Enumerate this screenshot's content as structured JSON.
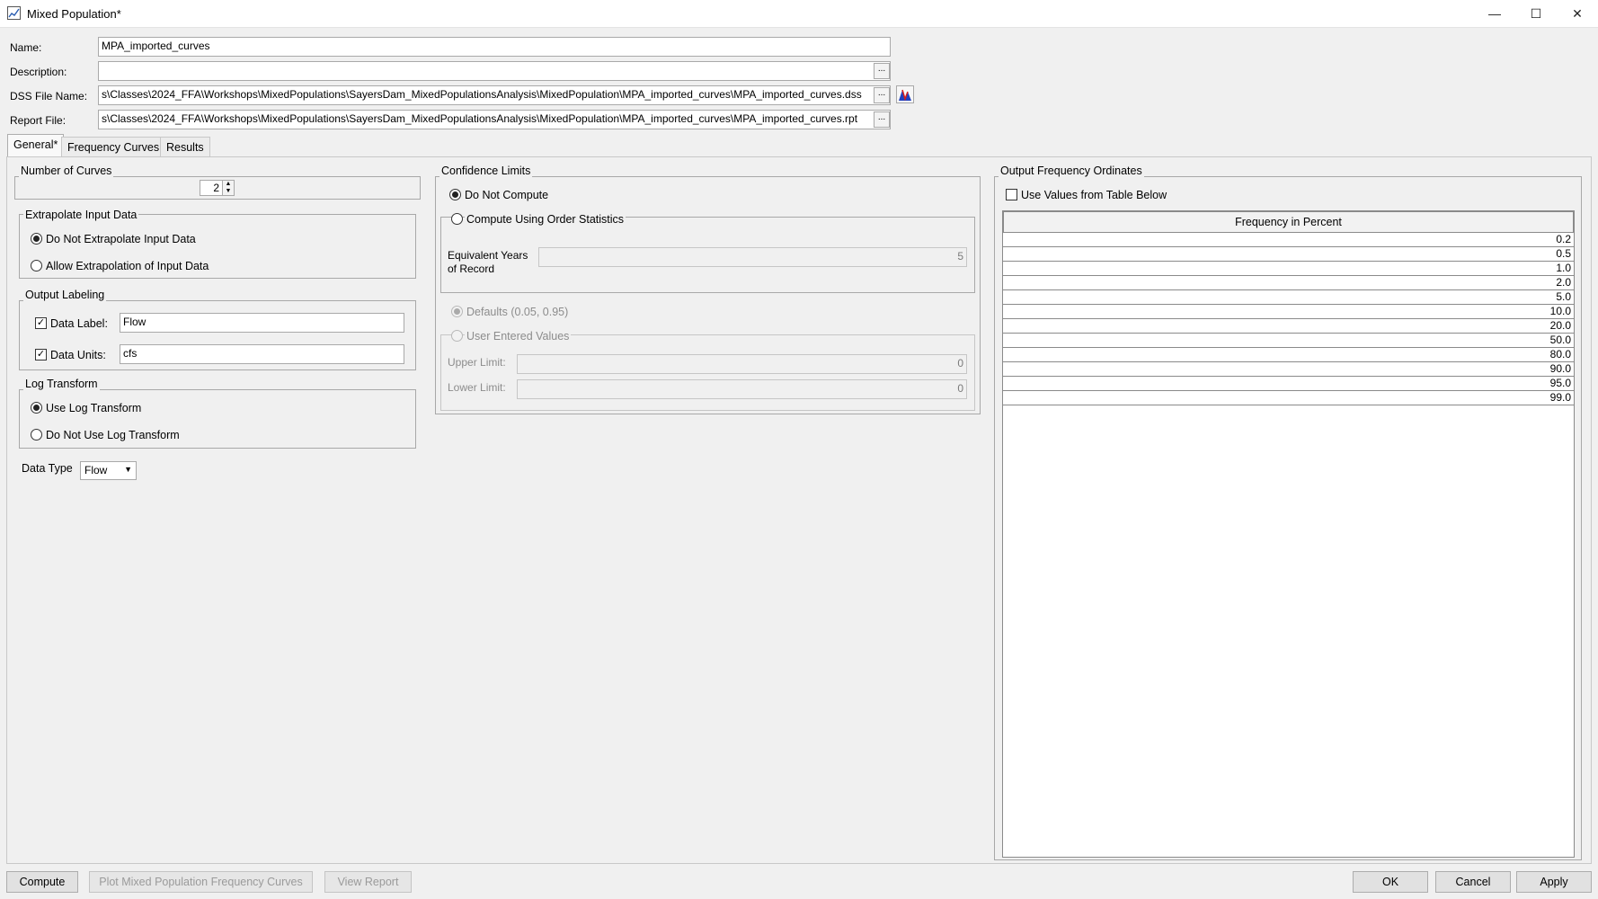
{
  "window": {
    "title": "Mixed Population*",
    "minimize": "—",
    "maximize": "☐",
    "close": "✕"
  },
  "header": {
    "name_label": "Name:",
    "name_value": "MPA_imported_curves",
    "description_label": "Description:",
    "description_value": "",
    "dss_label": "DSS File Name:",
    "dss_value": "s\\Classes\\2024_FFA\\Workshops\\MixedPopulations\\SayersDam_MixedPopulationsAnalysis\\MixedPopulation\\MPA_imported_curves\\MPA_imported_curves.dss",
    "report_label": "Report File:",
    "report_value": "s\\Classes\\2024_FFA\\Workshops\\MixedPopulations\\SayersDam_MixedPopulationsAnalysis\\MixedPopulation\\MPA_imported_curves\\MPA_imported_curves.rpt",
    "browse": "..."
  },
  "tabs": [
    "General*",
    "Frequency Curves",
    "Results"
  ],
  "general": {
    "num_curves": {
      "title": "Number of Curves",
      "value": "2"
    },
    "extrapolate": {
      "title": "Extrapolate Input Data",
      "options": [
        "Do Not Extrapolate Input Data",
        "Allow Extrapolation of Input Data"
      ],
      "selected": 0
    },
    "labeling": {
      "title": "Output Labeling",
      "data_label": "Data Label:",
      "data_label_value": "Flow",
      "data_units": "Data Units:",
      "data_units_value": "cfs"
    },
    "log_transform": {
      "title": "Log Transform",
      "options": [
        "Use Log Transform",
        "Do Not Use Log Transform"
      ],
      "selected": 0
    },
    "data_type": {
      "label": "Data Type",
      "value": "Flow"
    }
  },
  "confidence": {
    "title": "Confidence Limits",
    "do_not_compute": "Do Not Compute",
    "order_stats": "Compute Using Order Statistics",
    "equiv_years_1": "Equivalent Years",
    "equiv_years_2": "of Record",
    "equiv_years_value": "5",
    "defaults": "Defaults (0.05, 0.95)",
    "user_values": "User Entered Values",
    "upper_label": "Upper Limit:",
    "upper_value": "0",
    "lower_label": "Lower Limit:",
    "lower_value": "0"
  },
  "ordinates": {
    "title": "Output Frequency Ordinates",
    "use_values": "Use Values from Table Below",
    "column": "Frequency in Percent",
    "values": [
      "0.2",
      "0.5",
      "1.0",
      "2.0",
      "5.0",
      "10.0",
      "20.0",
      "50.0",
      "80.0",
      "90.0",
      "95.0",
      "99.0"
    ]
  },
  "buttons": {
    "compute": "Compute",
    "plot": "Plot Mixed Population Frequency Curves",
    "view_report": "View Report",
    "ok": "OK",
    "cancel": "Cancel",
    "apply": "Apply"
  }
}
